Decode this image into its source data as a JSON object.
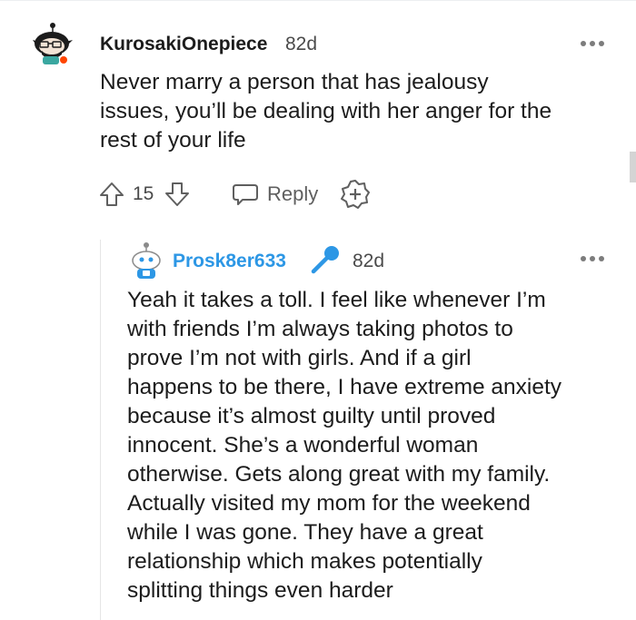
{
  "comments": [
    {
      "author": "KurosakiOnepiece",
      "age": "82d",
      "lines": [
        "Never marry a person that has jealousy",
        "issues, you’ll be dealing with her anger for the",
        "rest of your life"
      ],
      "votes": "15",
      "reply_label": "Reply"
    },
    {
      "author": "Prosk8er633",
      "author_color": "#2d97e5",
      "age": "82d",
      "lines": [
        "Yeah it takes a toll. I feel like whenever I’m",
        "with friends I’m always taking photos to",
        "prove I’m not with girls. And if a girl",
        "happens to be there, I have extreme anxiety",
        "because it’s almost guilty until proved",
        "innocent. She’s a wonderful woman",
        "otherwise. Gets along great with my family.",
        "Actually visited my mom for the weekend",
        "while I was gone. They have a great",
        "relationship which makes potentially",
        "splitting things even harder"
      ]
    }
  ],
  "icons": {
    "upvote": "arrow-up-icon",
    "downvote": "arrow-down-icon",
    "reply": "speech-bubble-icon",
    "award": "add-award-icon",
    "more": "more-dots-icon",
    "flair": "microphone-icon"
  }
}
